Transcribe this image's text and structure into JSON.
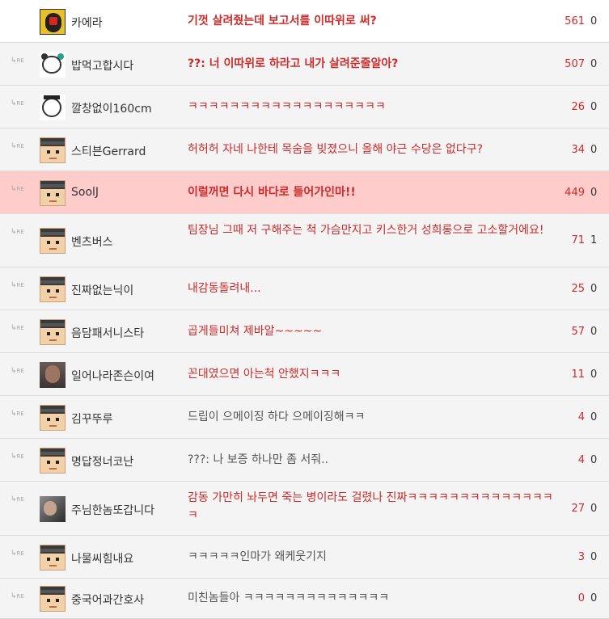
{
  "comments": [
    {
      "author": "카에라",
      "text": "기껏 살려줬는데 보고서를 이따위로 써?",
      "likes": "561",
      "hates": "0",
      "avatar": "red-mask-avatar",
      "reply": false,
      "text_style": "red-bold"
    },
    {
      "author": "밥먹고합시다",
      "text": "??: 너 이따위로 하라고 내가 살려준줄알아?",
      "likes": "507",
      "hates": "0",
      "avatar": "bear-avatar",
      "reply": true,
      "text_style": "red-bold"
    },
    {
      "author": "깔창없이160cm",
      "text": "ㅋㅋㅋㅋㅋㅋㅋㅋㅋㅋㅋㅋㅋㅋㅋㅋㅋㅋㅋ",
      "likes": "26",
      "hates": "0",
      "avatar": "graduate-avatar",
      "reply": true,
      "text_style": "red"
    },
    {
      "author": "스티븐Gerrard",
      "text": "허허허 자네 나한테 목숨을 빚졌으니 올해 야근 수당은 없다구?",
      "likes": "34",
      "hates": "0",
      "avatar": "default-avatar",
      "reply": true,
      "text_style": "red"
    },
    {
      "author": "SoolJ",
      "text": "이럴꺼면 다시 바다로 들어가인마!!",
      "likes": "449",
      "hates": "0",
      "avatar": "default-avatar",
      "reply": true,
      "text_style": "red-bold",
      "highlight": true
    },
    {
      "author": "벤츠버스",
      "text": "팀장님 그때 저 구해주는 척 가슴만지고 키스한거 성희롱으로 고소할거에요!",
      "likes": "71",
      "hates": "1",
      "avatar": "default-avatar",
      "reply": true,
      "text_style": "red"
    },
    {
      "author": "진짜없는닉이",
      "text": "내감동돌려내...",
      "likes": "25",
      "hates": "0",
      "avatar": "default-avatar",
      "reply": true,
      "text_style": "red"
    },
    {
      "author": "음담패서니스타",
      "text": "곱게들미쳐 제바알~~~~~",
      "likes": "57",
      "hates": "0",
      "avatar": "default-avatar",
      "reply": true,
      "text_style": "red"
    },
    {
      "author": "일어나라존슨이여",
      "text": "꼰대였으면 아는척 안했지ㅋㅋㅋ",
      "likes": "11",
      "hates": "0",
      "avatar": "bald-man-avatar",
      "reply": true,
      "text_style": "red"
    },
    {
      "author": "김꾸뚜루",
      "text": "드립이 으메이징 하다 으메이징해ㅋㅋ",
      "likes": "4",
      "hates": "0",
      "avatar": "default-avatar",
      "reply": true,
      "text_style": "normal"
    },
    {
      "author": "명답정너코난",
      "text": "???: 나 보증 하나만 좀 서줘..",
      "likes": "4",
      "hates": "0",
      "avatar": "default-avatar",
      "reply": true,
      "text_style": "normal"
    },
    {
      "author": "주님한놈또갑니다",
      "text": "감동 가만히 놔두면 죽는 병이라도 걸렸나 진짜ㅋㅋㅋㅋㅋㅋㅋㅋㅋㅋㅋㅋㅋㅋㅋ",
      "likes": "27",
      "hates": "0",
      "avatar": "photo-avatar",
      "reply": true,
      "text_style": "red"
    },
    {
      "author": "나물씨힘내요",
      "text": "ㅋㅋㅋㅋㅋ인마가 왜케웃기지",
      "likes": "3",
      "hates": "0",
      "avatar": "default-avatar",
      "reply": true,
      "text_style": "normal"
    },
    {
      "author": "중국어과간호사",
      "text": "미친놈들아 ㅋㅋㅋㅋㅋㅋㅋㅋㅋㅋㅋㅋㅋㅋ",
      "likes": "0",
      "hates": "0",
      "avatar": "default-avatar",
      "reply": true,
      "text_style": "normal"
    }
  ],
  "reply_marker": "RE",
  "colors": {
    "accent": "#cc2b2b",
    "highlight_row": "#ffcccc",
    "row_alt": "#f4f4f4",
    "text": "#333333"
  }
}
